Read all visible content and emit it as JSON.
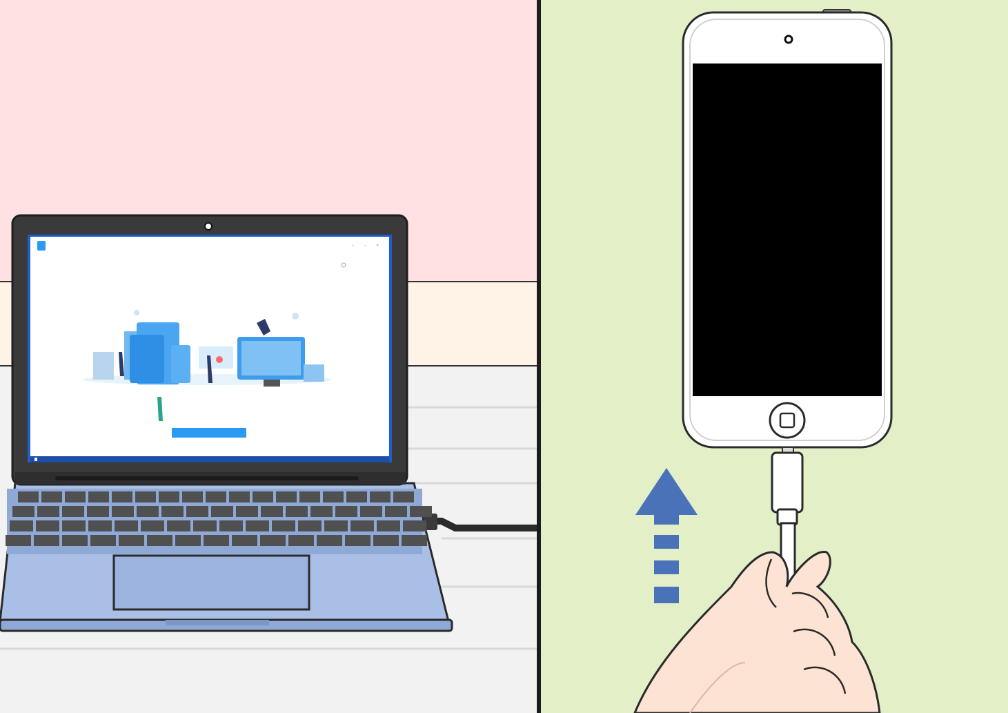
{
  "left_panel": {
    "background_color": "#ffe0e3",
    "table_color": "#f2f2f2",
    "laptop": {
      "body_color": "#a9bfe6",
      "keyboard_color": "#505050",
      "screen_app": {
        "window_title": "",
        "heading": "",
        "help_text": "",
        "window_controls": [
          "–",
          "–",
          "✕"
        ],
        "start_button_label": "",
        "accent_color": "#2b9af3"
      }
    }
  },
  "right_panel": {
    "background_color": "#e2efc7",
    "device": {
      "body_color": "#ffffff",
      "screen_color": "#000000"
    },
    "direction_arrow": {
      "icon": "up-arrow-icon",
      "color": "#4a72b8"
    }
  }
}
